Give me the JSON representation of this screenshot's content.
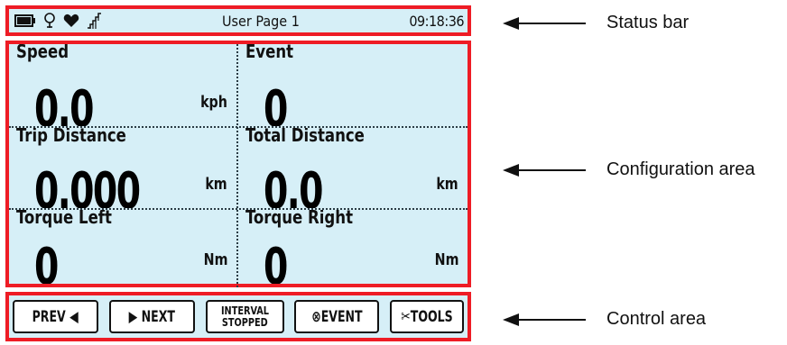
{
  "status_bar": {
    "title": "User Page 1",
    "time": "09:18:36",
    "icons": [
      "battery-icon",
      "gps-icon",
      "heart-icon",
      "signal-icon"
    ]
  },
  "config": {
    "cells": [
      {
        "label": "Speed",
        "value": "0.0",
        "unit": "kph"
      },
      {
        "label": "Event",
        "value": "0",
        "unit": ""
      },
      {
        "label": "Trip Distance",
        "value": "0.000",
        "unit": "km"
      },
      {
        "label": "Total Distance",
        "value": "0.0",
        "unit": "km"
      },
      {
        "label": "Torque Left",
        "value": "0",
        "unit": "Nm"
      },
      {
        "label": "Torque Right",
        "value": "0",
        "unit": "Nm"
      }
    ]
  },
  "controls": {
    "prev": "PREV ◀",
    "next": "▶ NEXT",
    "interval_line1": "INTERVAL",
    "interval_line2": "STOPPED",
    "event": "⊗EVENT",
    "tools": "✂TOOLS"
  },
  "annotations": {
    "status_bar": "Status bar",
    "config_area": "Configuration area",
    "control_area": "Control area"
  },
  "colors": {
    "highlight": "#ee1c25",
    "screen": "#d6eff7"
  }
}
